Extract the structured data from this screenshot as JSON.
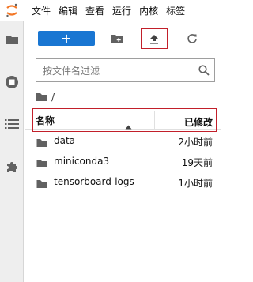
{
  "menu": {
    "items": [
      "文件",
      "编辑",
      "查看",
      "运行",
      "内核",
      "标签"
    ]
  },
  "toolbar": {
    "new_label": "+"
  },
  "filter": {
    "placeholder": "按文件名过滤"
  },
  "breadcrumb": {
    "separator": "/"
  },
  "listing": {
    "headers": {
      "name": "名称",
      "modified": "已修改"
    },
    "rows": [
      {
        "name": "data",
        "modified": "2小时前",
        "icon": "folder-icon"
      },
      {
        "name": "miniconda3",
        "modified": "19天前",
        "icon": "folder-icon"
      },
      {
        "name": "tensorboard-logs",
        "modified": "1小时前",
        "icon": "folder-icon"
      }
    ]
  },
  "colors": {
    "accent": "#1976d2",
    "highlight_box": "#c21f2a",
    "logo": "#f37726"
  }
}
